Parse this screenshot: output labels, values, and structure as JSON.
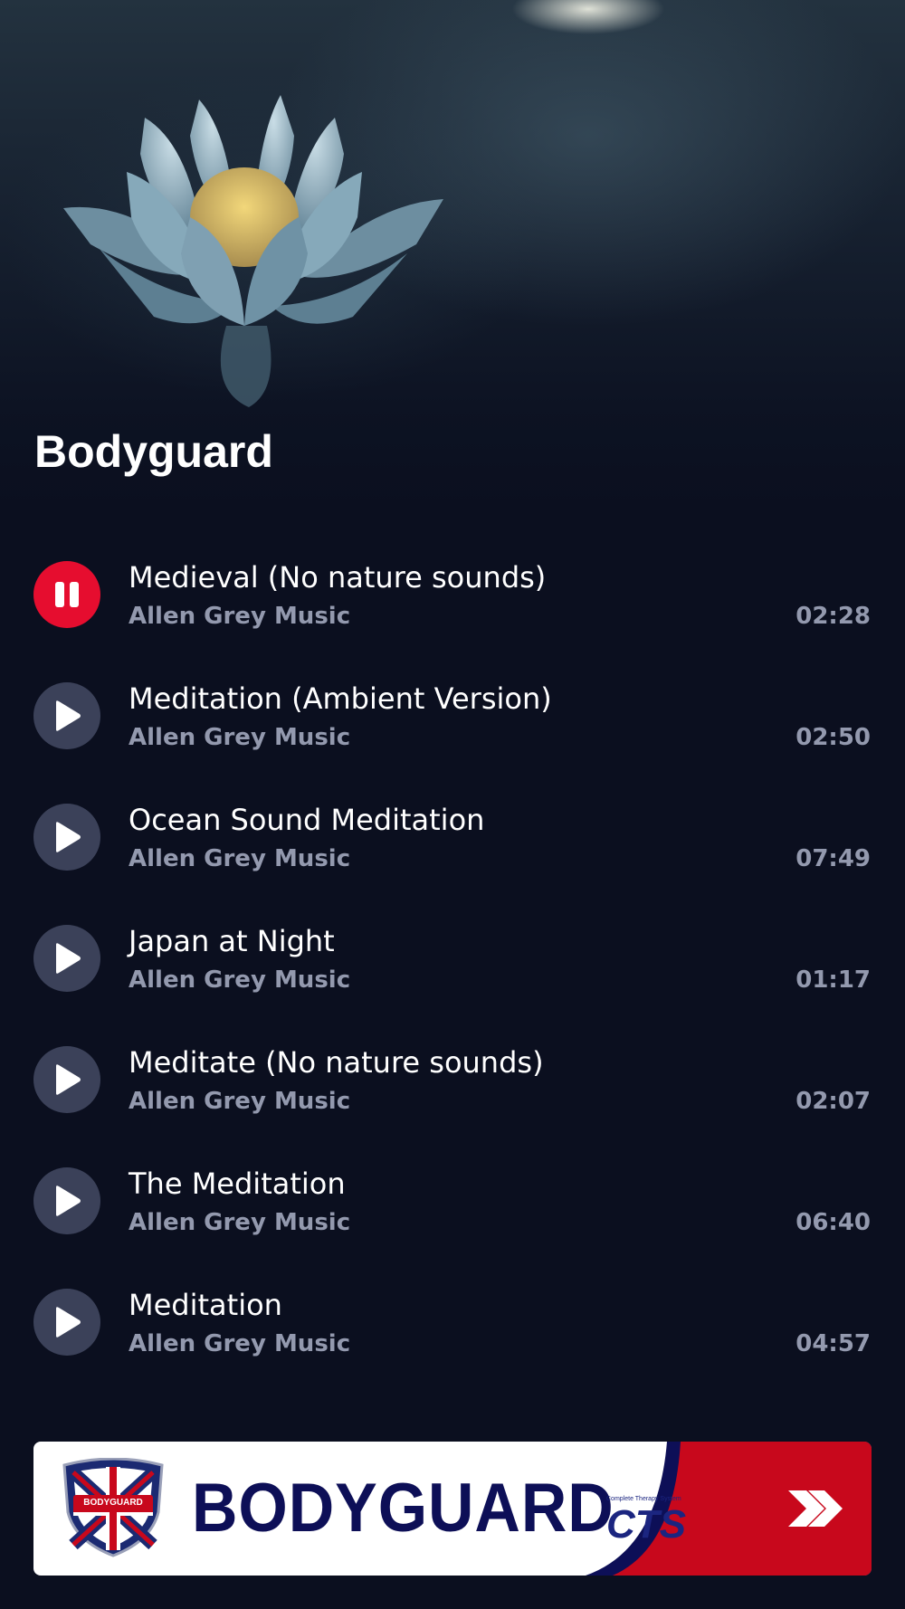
{
  "header": {
    "title": "Bodyguard",
    "artwork_icon": "lotus-flower-image"
  },
  "tracks": [
    {
      "title": "Medieval (No nature sounds)",
      "artist": "Allen Grey Music",
      "duration": "02:28",
      "state": "playing",
      "button_icon": "pause-icon"
    },
    {
      "title": "Meditation (Ambient Version)",
      "artist": "Allen Grey Music",
      "duration": "02:50",
      "state": "paused",
      "button_icon": "play-icon"
    },
    {
      "title": "Ocean Sound Meditation",
      "artist": "Allen Grey Music",
      "duration": "07:49",
      "state": "paused",
      "button_icon": "play-icon"
    },
    {
      "title": "Japan at Night",
      "artist": "Allen Grey Music",
      "duration": "01:17",
      "state": "paused",
      "button_icon": "play-icon"
    },
    {
      "title": "Meditate (No nature sounds)",
      "artist": "Allen Grey Music",
      "duration": "02:07",
      "state": "paused",
      "button_icon": "play-icon"
    },
    {
      "title": "The Meditation",
      "artist": "Allen Grey Music",
      "duration": "06:40",
      "state": "paused",
      "button_icon": "play-icon"
    },
    {
      "title": "Meditation",
      "artist": "Allen Grey Music",
      "duration": "04:57",
      "state": "paused",
      "button_icon": "play-icon"
    }
  ],
  "banner": {
    "brand": "BODYGUARD",
    "badge_text": "BODYGUARD",
    "sub_brand": "CTS",
    "sub_brand_tagline": "Complete Therapy System",
    "arrow_icon": "double-chevron-right-icon"
  },
  "colors": {
    "background": "#0b0f1f",
    "accent_red": "#e60d2f",
    "play_button": "#3b4159",
    "secondary_text": "#9399ae",
    "brand_navy": "#0d0f57"
  }
}
